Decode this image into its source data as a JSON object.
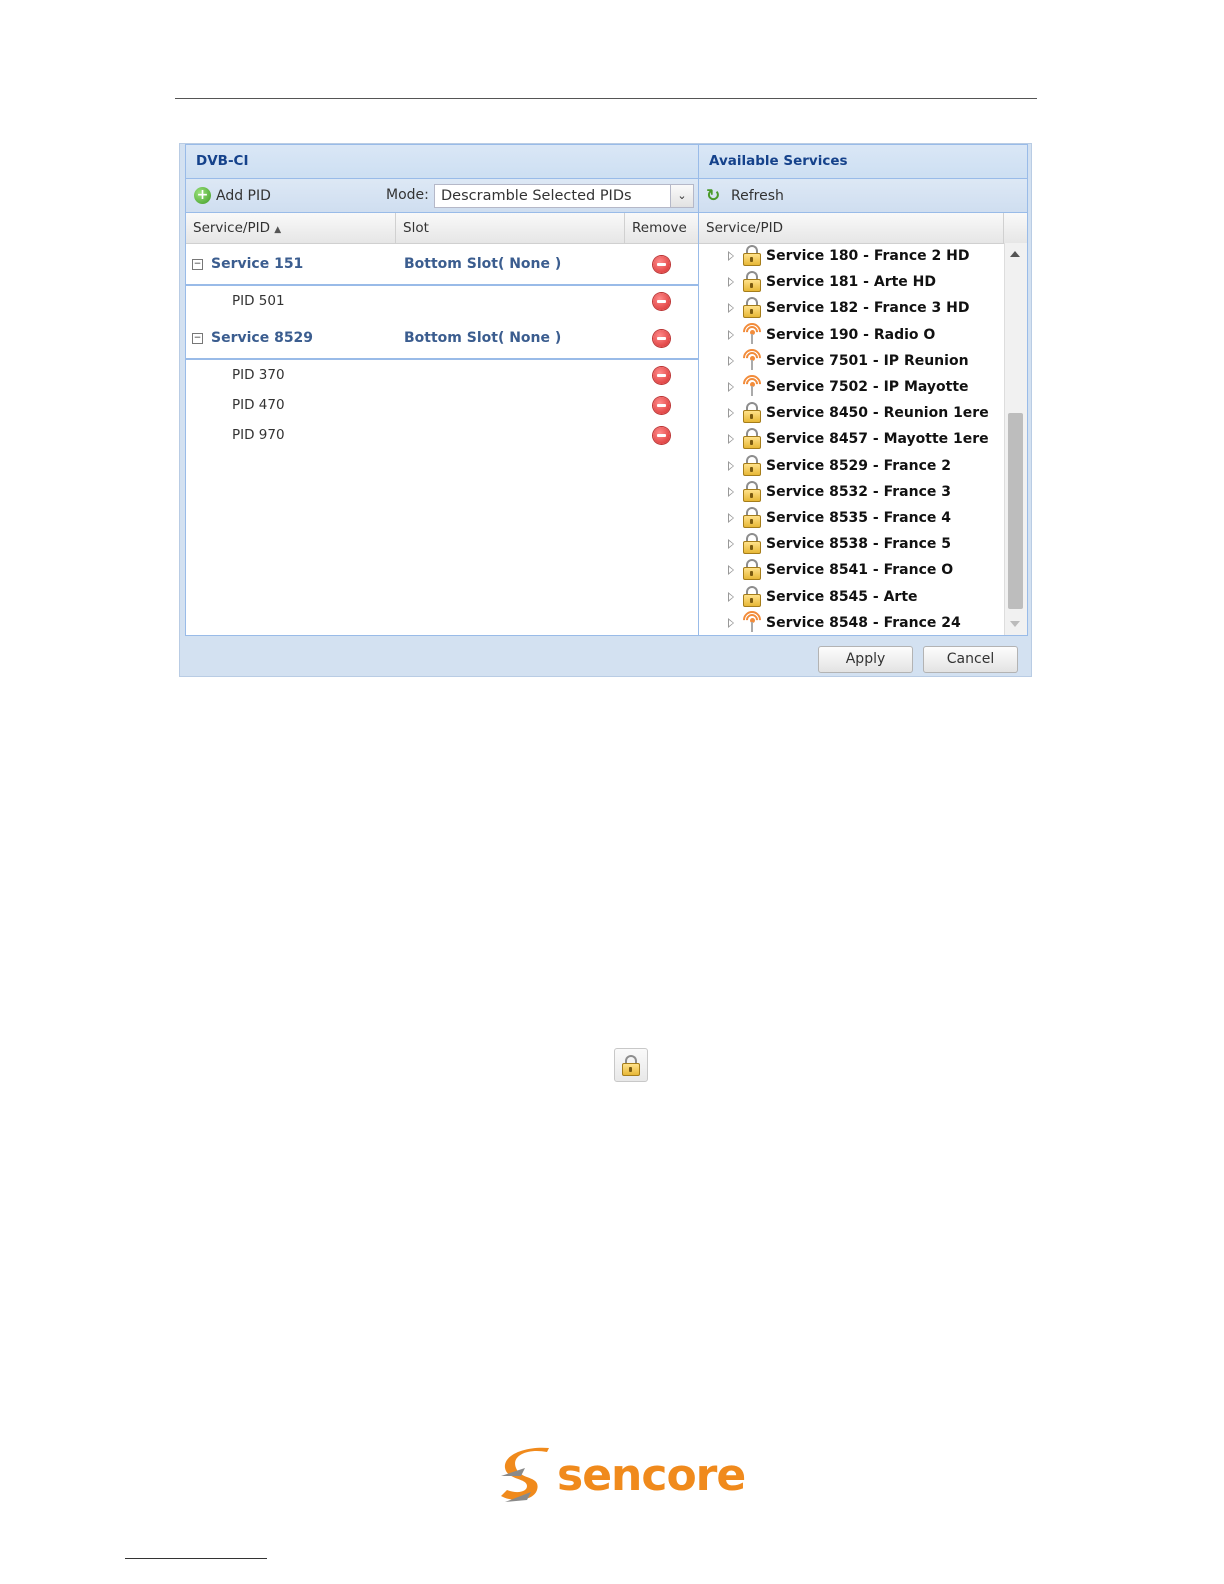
{
  "dialog": {
    "left_panel": {
      "title": "DVB-CI",
      "toolbar": {
        "add_pid_label": "Add PID",
        "mode_label": "Mode:",
        "mode_value": "Descramble Selected PIDs"
      },
      "columns": {
        "service_pid": "Service/PID",
        "slot": "Slot",
        "remove": "Remove"
      },
      "groups": [
        {
          "service": "Service 151",
          "slot": "Bottom Slot( None )",
          "pids": [
            "PID 501"
          ]
        },
        {
          "service": "Service 8529",
          "slot": "Bottom Slot( None )",
          "pids": [
            "PID 370",
            "PID 470",
            "PID 970"
          ]
        }
      ]
    },
    "right_panel": {
      "title": "Available Services",
      "toolbar": {
        "refresh_label": "Refresh"
      },
      "columns": {
        "service_pid": "Service/PID"
      },
      "services": [
        {
          "label": "Service 180 - France 2 HD",
          "icon": "lock-icon"
        },
        {
          "label": "Service 181 - Arte HD",
          "icon": "lock-icon"
        },
        {
          "label": "Service 182 - France 3 HD",
          "icon": "lock-icon"
        },
        {
          "label": "Service 190 - Radio O",
          "icon": "radio-icon"
        },
        {
          "label": "Service 7501 - IP Reunion",
          "icon": "radio-icon"
        },
        {
          "label": "Service 7502 - IP Mayotte",
          "icon": "radio-icon"
        },
        {
          "label": "Service 8450 - Reunion 1ere",
          "icon": "lock-icon"
        },
        {
          "label": "Service 8457 - Mayotte 1ere",
          "icon": "lock-icon"
        },
        {
          "label": "Service 8529 - France 2",
          "icon": "lock-icon"
        },
        {
          "label": "Service 8532 - France 3",
          "icon": "lock-icon"
        },
        {
          "label": "Service 8535 - France 4",
          "icon": "lock-icon"
        },
        {
          "label": "Service 8538 - France 5",
          "icon": "lock-icon"
        },
        {
          "label": "Service 8541 - France O",
          "icon": "lock-icon"
        },
        {
          "label": "Service 8545 - Arte",
          "icon": "lock-icon"
        },
        {
          "label": "Service 8548 - France 24",
          "icon": "radio-icon"
        }
      ]
    },
    "buttons": {
      "apply": "Apply",
      "cancel": "Cancel"
    }
  },
  "standalone_icon": "lock-icon",
  "footer_logo": {
    "text": "sencore",
    "color": "#f08a1c"
  }
}
